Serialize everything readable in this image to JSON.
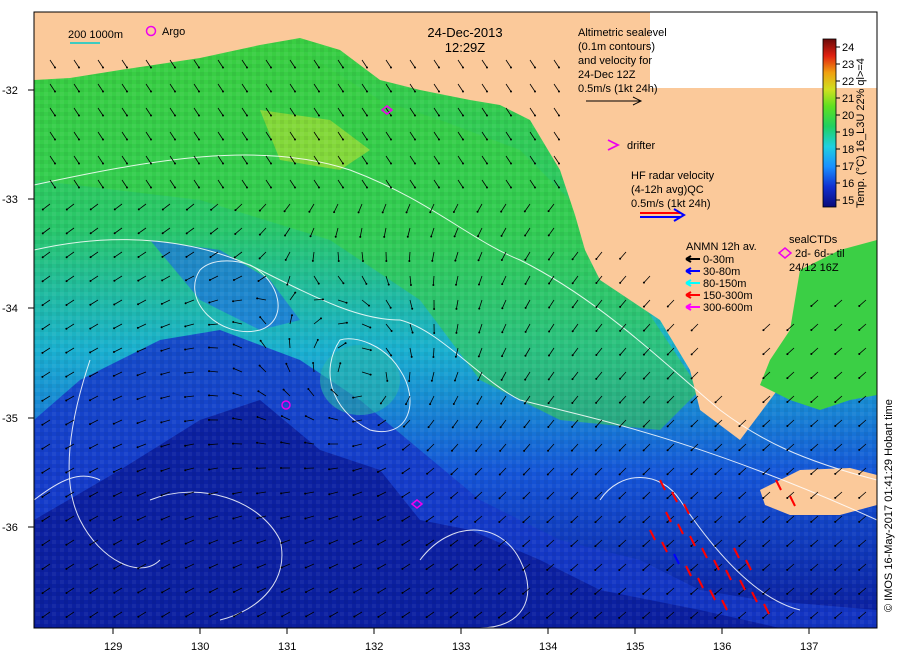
{
  "header": {
    "date": "24-Dec-2013",
    "time": "12:29Z"
  },
  "legend_top_left": {
    "scale_bar": "200  1000m",
    "argo": "Argo"
  },
  "altimetry": {
    "lines": [
      "Altimetric sealevel",
      "(0.1m contours)",
      "and velocity for",
      "24-Dec 12Z",
      "0.5m/s (1kt 24h)"
    ]
  },
  "drifter": {
    "label": "drifter",
    "color": "#ee00ee"
  },
  "hf_radar": {
    "lines": [
      "HF radar velocity",
      "(4-12h avg)QC",
      "0.5m/s (1kt 24h)"
    ],
    "colors": [
      "#ff0000",
      "#0000ff"
    ]
  },
  "anmn": {
    "title": "ANMN 12h av.",
    "items": [
      {
        "label": "0-30m",
        "color": "#000000"
      },
      {
        "label": "30-80m",
        "color": "#0000ff"
      },
      {
        "label": "80-150m",
        "color": "#00ffff"
      },
      {
        "label": "150-300m",
        "color": "#ff0000"
      },
      {
        "label": "300-600m",
        "color": "#ff00ff"
      }
    ]
  },
  "seal_ctds": {
    "title": "sealCTDs",
    "line1": "2d- 6d-- til",
    "line2": "24/12 16Z"
  },
  "colorbar": {
    "label": "Temp. (°C) 16_L3U 22% ql>=4",
    "ticks": [
      "24",
      "23",
      "22",
      "21",
      "20",
      "19",
      "18",
      "17",
      "16",
      "15"
    ]
  },
  "credit": "© IMOS 16-May-2017 01:41:29 Hobart time",
  "axes": {
    "x_ticks": [
      "129",
      "130",
      "131",
      "132",
      "133",
      "134",
      "135",
      "136",
      "137"
    ],
    "y_ticks": [
      "-32",
      "-33",
      "-34",
      "-35",
      "-36"
    ]
  },
  "colors": {
    "land": "#fbc99a",
    "sst_warm": "#33cc44",
    "sst_cold": "#0a1aa0"
  }
}
